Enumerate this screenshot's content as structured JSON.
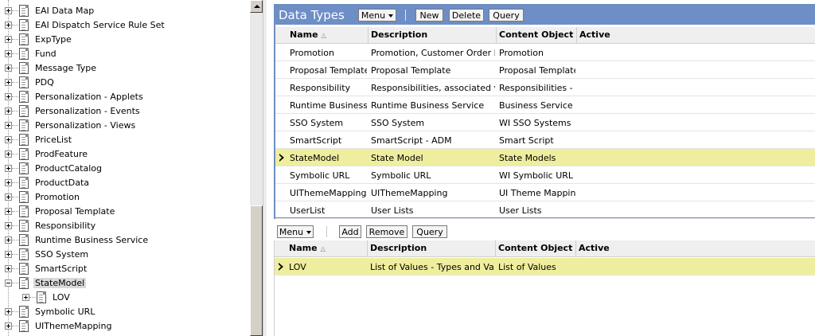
{
  "tree": {
    "items": [
      {
        "label": "EAI Data Map",
        "expand": "plus"
      },
      {
        "label": "EAI Dispatch Service Rule Set",
        "expand": "plus"
      },
      {
        "label": "ExpType",
        "expand": "plus"
      },
      {
        "label": "Fund",
        "expand": "plus"
      },
      {
        "label": "Message Type",
        "expand": "plus"
      },
      {
        "label": "PDQ",
        "expand": "plus"
      },
      {
        "label": "Personalization - Applets",
        "expand": "plus"
      },
      {
        "label": "Personalization - Events",
        "expand": "plus"
      },
      {
        "label": "Personalization - Views",
        "expand": "plus"
      },
      {
        "label": "PriceList",
        "expand": "plus"
      },
      {
        "label": "ProdFeature",
        "expand": "plus"
      },
      {
        "label": "ProductCatalog",
        "expand": "plus"
      },
      {
        "label": "ProductData",
        "expand": "plus"
      },
      {
        "label": "Promotion",
        "expand": "plus"
      },
      {
        "label": "Proposal Template",
        "expand": "plus"
      },
      {
        "label": "Responsibility",
        "expand": "plus"
      },
      {
        "label": "Runtime Business Service",
        "expand": "plus"
      },
      {
        "label": "SSO System",
        "expand": "plus"
      },
      {
        "label": "SmartScript",
        "expand": "plus"
      },
      {
        "label": "StateModel",
        "expand": "minus",
        "selected": true
      },
      {
        "label": "LOV",
        "expand": "plus",
        "child": true
      },
      {
        "label": "Symbolic URL",
        "expand": "plus"
      },
      {
        "label": "UIThemeMapping",
        "expand": "plus"
      }
    ]
  },
  "applet1": {
    "title": "Data Types",
    "buttons": {
      "menu": "Menu",
      "new": "New",
      "delete": "Delete",
      "query": "Query"
    },
    "columns": [
      "Name",
      "Description",
      "Content Object",
      "Active"
    ],
    "rows": [
      [
        "Promotion",
        "Promotion, Customer Order Mana",
        "Promotion",
        ""
      ],
      [
        "Proposal Template",
        "Proposal Template",
        "Proposal Template",
        ""
      ],
      [
        "Responsibility",
        "Responsibilities, associated views",
        "Responsibilities - Vie",
        ""
      ],
      [
        "Runtime Business Se",
        "Runtime Business Service",
        "Business Service",
        ""
      ],
      [
        "SSO System",
        "SSO System",
        "WI SSO Systems",
        ""
      ],
      [
        "SmartScript",
        "SmartScript - ADM",
        "Smart Script",
        ""
      ],
      [
        "StateModel",
        "State Model",
        "State Models",
        ""
      ],
      [
        "Symbolic URL",
        "Symbolic URL",
        "WI Symbolic URL",
        ""
      ],
      [
        "UIThemeMapping",
        "UIThemeMapping",
        "UI Theme Mapping",
        ""
      ],
      [
        "UserList",
        "User Lists",
        "User Lists",
        ""
      ]
    ],
    "selected_row": 6
  },
  "applet2": {
    "buttons": {
      "menu": "Menu",
      "add": "Add",
      "remove": "Remove",
      "query": "Query"
    },
    "columns": [
      "Name",
      "Description",
      "Content Object",
      "Active"
    ],
    "rows": [
      [
        "LOV",
        "List of Values - Types and Values",
        "List of Values",
        ""
      ]
    ],
    "selected_row": 0
  },
  "colors": {
    "header_blue": "#6d8ec6",
    "selected_row": "#eeee9e"
  }
}
